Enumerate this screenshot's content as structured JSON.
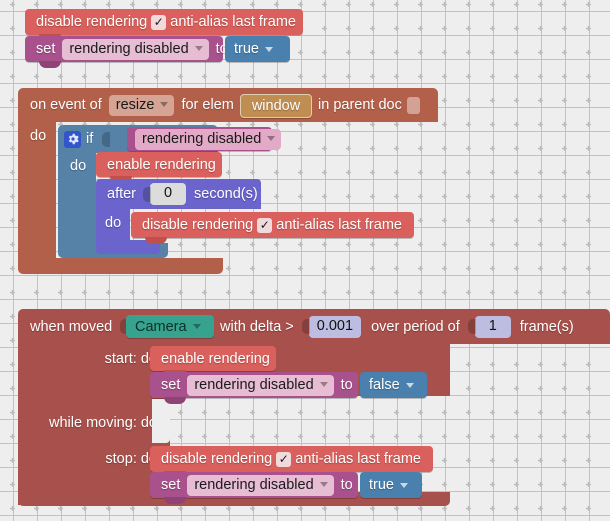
{
  "app": {
    "name": "visual-block-editor",
    "workspace_label": "Blockly workspace",
    "background_color": "#eeeeee",
    "grid_mark": "plus"
  },
  "palette": {
    "rendering_block": "#d9605c",
    "set_variable_block": "#a8518c",
    "boolean_value_block": "#4a80ad",
    "event_block": "#b3604a",
    "control_block": "#5782a8",
    "timing_block": "#6a64cc",
    "movement_block": "#a8504b",
    "element_block": "#c08d52",
    "object_block": "#37a38f"
  },
  "groups": [
    {
      "id": "group-1",
      "name": "standalone-disable-stack",
      "blocks": [
        {
          "name": "disable-rendering-block",
          "text_1": "disable rendering",
          "checkbox_checked": true,
          "checkbox_glyph": "✓",
          "text_2": "anti-alias last frame"
        },
        {
          "name": "set-variable-block",
          "text_1": "set",
          "variable": "rendering disabled",
          "text_2": "to",
          "value": "true"
        }
      ]
    },
    {
      "id": "group-2",
      "name": "on-event-resize-stack",
      "header": {
        "name": "on-event-block",
        "text_1": "on event of",
        "event": "resize",
        "text_2": "for elem",
        "element": "window",
        "text_3": "in parent doc",
        "parent_doc_value": ""
      },
      "do_label": "do",
      "if_block": {
        "name": "if-block",
        "gear_icon": "gear-icon",
        "text_1": "if",
        "condition": "rendering disabled",
        "do_label": "do"
      },
      "enable_block": {
        "name": "enable-rendering-block",
        "text_1": "enable rendering"
      },
      "after_block": {
        "name": "after-seconds-block",
        "text_1": "after",
        "seconds": "0",
        "text_2": "second(s)",
        "do_label": "do"
      },
      "inner_disable_block": {
        "name": "disable-rendering-block",
        "text_1": "disable rendering",
        "checkbox_checked": true,
        "checkbox_glyph": "✓",
        "text_2": "anti-alias last frame"
      }
    },
    {
      "id": "group-3",
      "name": "when-moved-stack",
      "header": {
        "name": "when-moved-block",
        "text_1": "when moved",
        "target": "Camera",
        "text_2": "with delta >",
        "delta": "0.001",
        "text_3": "over period of",
        "period": "1",
        "text_4": "frame(s)"
      },
      "slots": [
        {
          "name": "start-slot",
          "label": "start: do"
        },
        {
          "name": "while-moving-slot",
          "label": "while moving: do"
        },
        {
          "name": "stop-slot",
          "label": "stop: do"
        }
      ],
      "start_blocks": [
        {
          "name": "enable-rendering-block",
          "text_1": "enable rendering"
        },
        {
          "name": "set-variable-block",
          "text_1": "set",
          "variable": "rendering disabled",
          "text_2": "to",
          "value": "false"
        }
      ],
      "while_moving_blocks": [],
      "stop_blocks": [
        {
          "name": "disable-rendering-block",
          "text_1": "disable rendering",
          "checkbox_checked": true,
          "checkbox_glyph": "✓",
          "text_2": "anti-alias last frame"
        },
        {
          "name": "set-variable-block",
          "text_1": "set",
          "variable": "rendering disabled",
          "text_2": "to",
          "value": "true"
        }
      ]
    }
  ]
}
